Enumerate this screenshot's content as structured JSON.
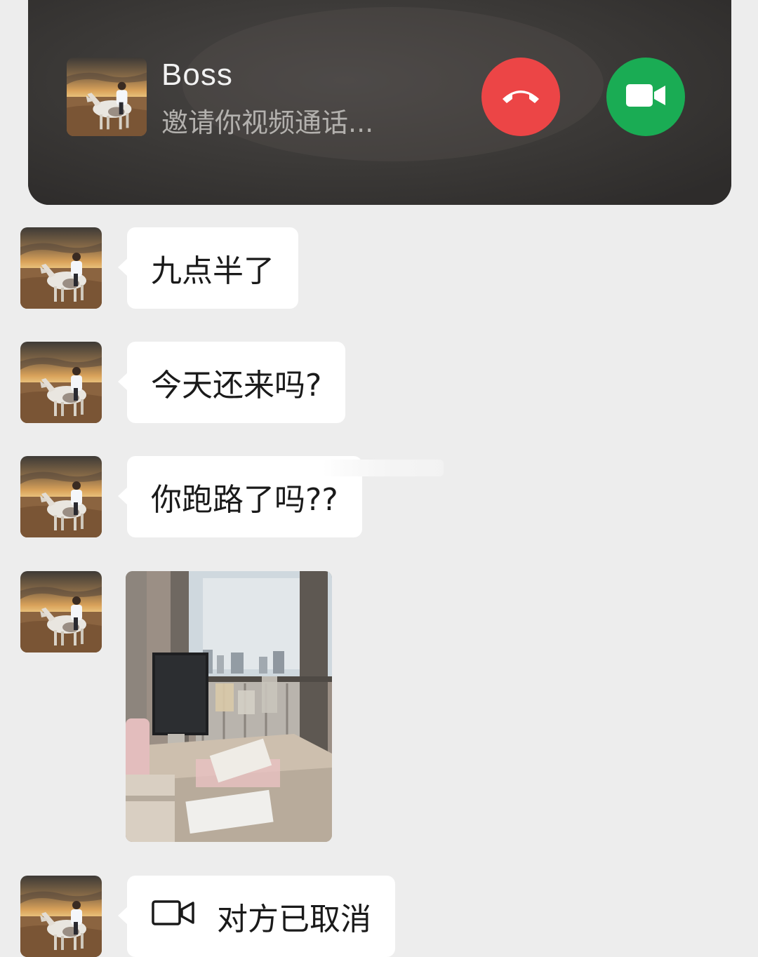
{
  "call_banner": {
    "caller_name": "Boss",
    "status_text": "邀请你视频通话...",
    "decline_icon": "hang-up-icon",
    "accept_icon": "video-camera-icon",
    "colors": {
      "decline": "#ec4546",
      "accept": "#1aac54"
    }
  },
  "messages": [
    {
      "type": "text",
      "text": "九点半了"
    },
    {
      "type": "text",
      "text": "今天还来吗?"
    },
    {
      "type": "text",
      "text": "你跑路了吗??"
    },
    {
      "type": "image",
      "description_icon": "photo-thumbnail"
    },
    {
      "type": "call",
      "icon": "video-call-icon",
      "text": "对方已取消"
    }
  ],
  "colors": {
    "chat_background": "#ededed",
    "bubble": "#ffffff"
  }
}
